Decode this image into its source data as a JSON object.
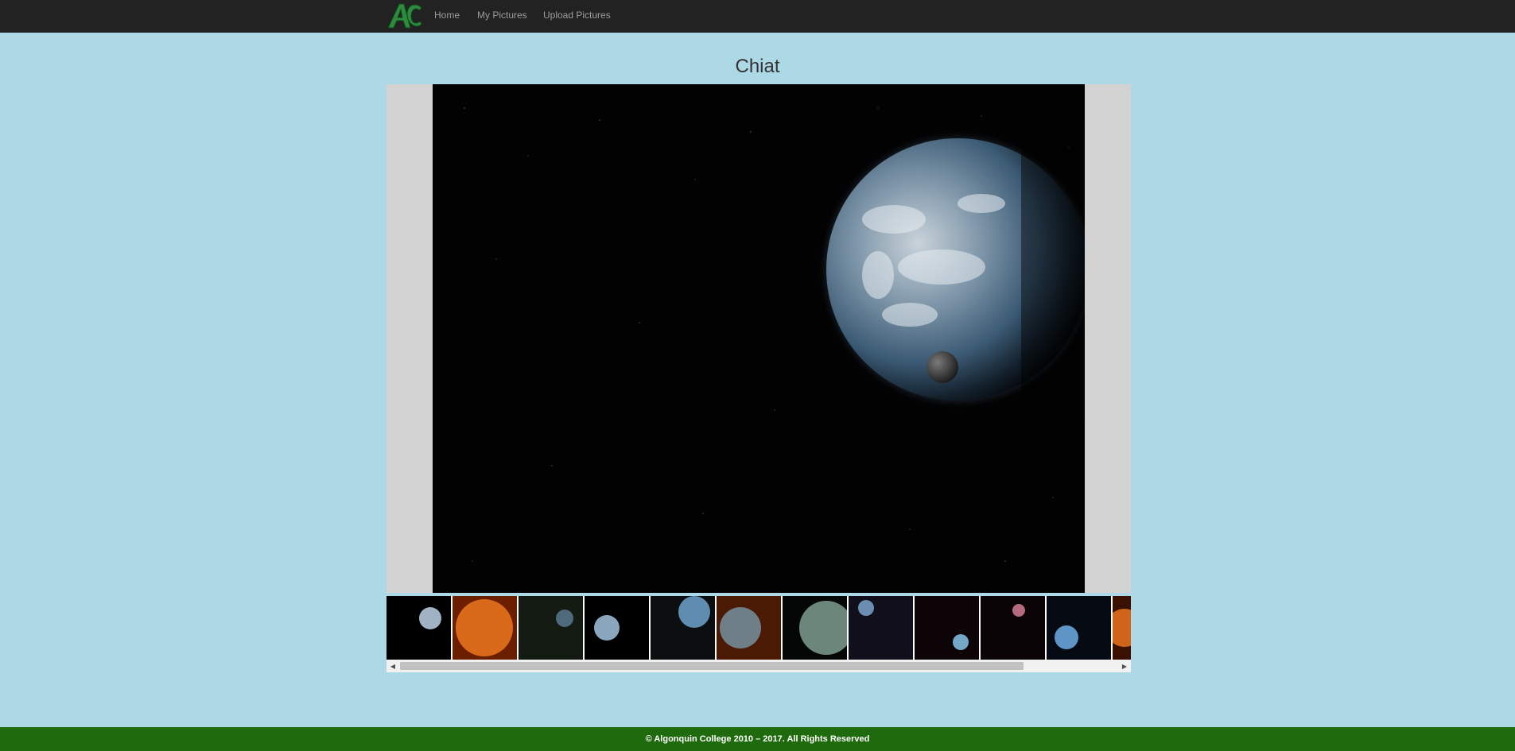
{
  "nav": {
    "logo_text": "AC",
    "items": [
      {
        "label": "Home"
      },
      {
        "label": "My Pictures"
      },
      {
        "label": "Upload Pictures"
      }
    ]
  },
  "album": {
    "title": "Chiat"
  },
  "thumbnails_icon": "planet-thumbnail-icon",
  "scrollbar": {
    "left_arrow": "◀",
    "right_arrow": "▶"
  },
  "footer": {
    "text": "© Algonquin College 2010 – 2017. All Rights Reserved"
  },
  "colors": {
    "navbar": "#222222",
    "page_background": "#add8e6",
    "footer": "#1e6a0d",
    "viewer_background": "#d3d3d3"
  }
}
